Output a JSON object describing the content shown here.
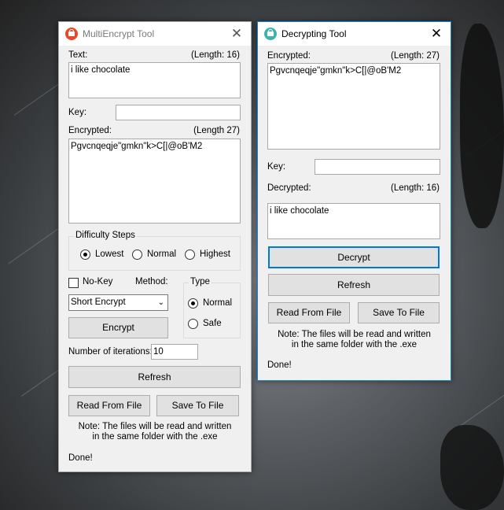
{
  "main_window": {
    "title": "MultiEncrypt Tool",
    "text_label": "Text:",
    "text_length": "(Length: 16)",
    "text_value": "i like chocolate",
    "key_label": "Key:",
    "key_value": "",
    "encrypted_label": "Encrypted:",
    "encrypted_length": "(Length 27)",
    "encrypted_value": "Pgvcnqeqje\"gmkn\"k>C[|@oB'M2",
    "difficulty_group": "Difficulty Steps",
    "difficulty_options": [
      "Lowest",
      "Normal",
      "Highest"
    ],
    "difficulty_selected": "Lowest",
    "nokey_label": "No-Key",
    "method_label": "Method:",
    "method_value": "Short Encrypt",
    "type_group": "Type",
    "type_options": [
      "Normal",
      "Safe"
    ],
    "type_selected": "Normal",
    "encrypt_button": "Encrypt",
    "iterations_label": "Number of iterations:",
    "iterations_value": "10",
    "refresh_button": "Refresh",
    "read_button": "Read From File",
    "save_button": "Save To File",
    "note_line1": "Note: The files will be read and written",
    "note_line2": "in the same folder with the .exe",
    "status": "Done!"
  },
  "decrypt_window": {
    "title": "Decrypting Tool",
    "encrypted_label": "Encrypted:",
    "encrypted_length": "(Length: 27)",
    "encrypted_value": "Pgvcnqeqje\"gmkn\"k>C[|@oB'M2",
    "key_label": "Key:",
    "key_value": "",
    "decrypted_label": "Decrypted:",
    "decrypted_length": "(Length: 16)",
    "decrypted_value": "i like chocolate",
    "decrypt_button": "Decrypt",
    "refresh_button": "Refresh",
    "read_button": "Read From File",
    "save_button": "Save To File",
    "note_line1": "Note: The files will be read and written",
    "note_line2": "in the same folder with the .exe",
    "status": "Done!"
  },
  "colors": {
    "main_icon": "#e8472a",
    "decrypt_icon": "#3fb3a8",
    "focus_border": "#0078d7"
  }
}
